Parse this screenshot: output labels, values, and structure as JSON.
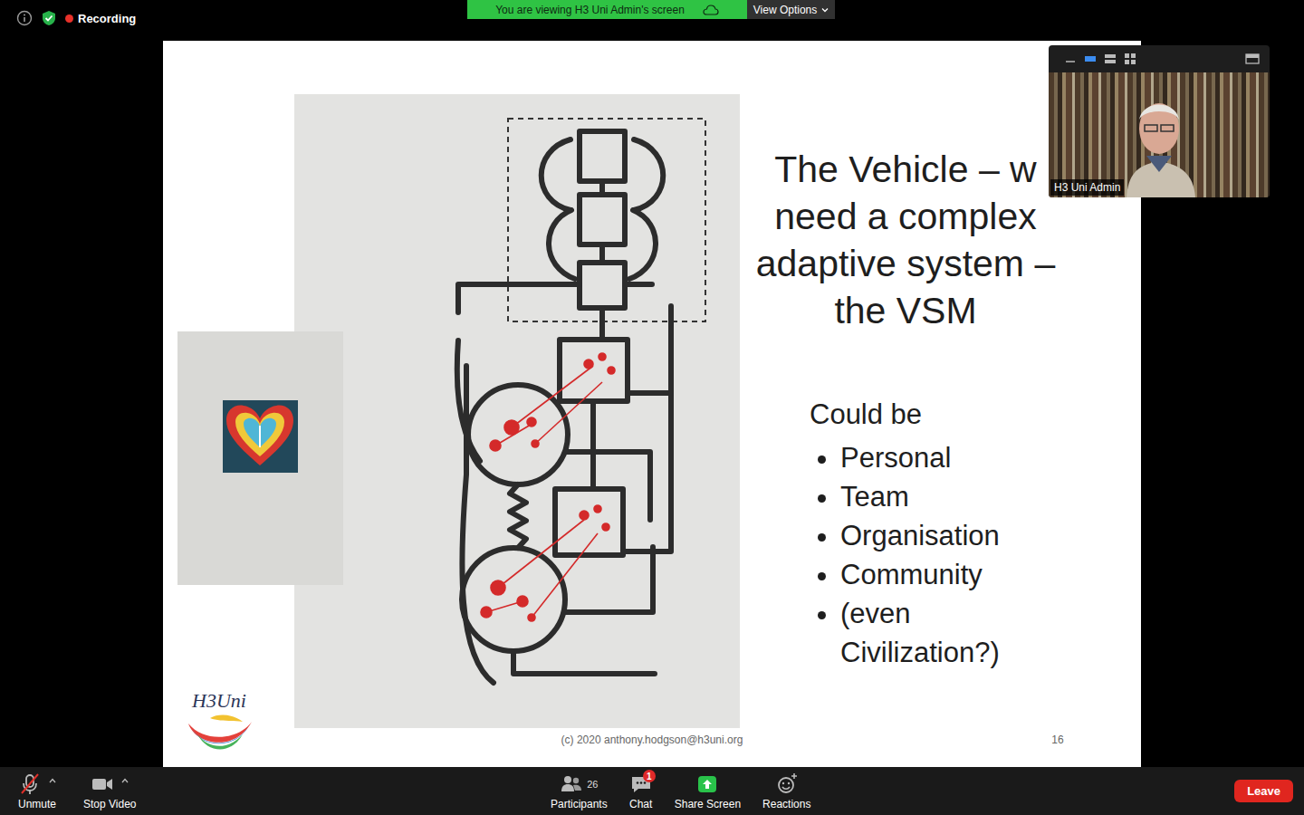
{
  "top_bar": {
    "recording": "Recording",
    "recording_on": true,
    "banner": "You are viewing H3 Uni Admin's screen",
    "view_options": "View Options"
  },
  "slide": {
    "title_lines": [
      "The Vehicle – w",
      "need a complex",
      "adaptive system –",
      "the VSM"
    ],
    "list_heading": "Could be",
    "items": [
      "Personal",
      "Team",
      "Organisation",
      "Community",
      "(even Civilization?)"
    ],
    "footer": "(c) 2020 anthony.hodgson@h3uni.org",
    "page": "16",
    "logo": "H3Uni"
  },
  "video": {
    "name": "H3 Uni Admin"
  },
  "toolbar": {
    "left": [
      {
        "label": "Unmute",
        "kind": "mic",
        "muted": true
      },
      {
        "label": "Stop Video",
        "kind": "video"
      }
    ],
    "center": [
      {
        "label": "Participants",
        "kind": "participants",
        "count": "26"
      },
      {
        "label": "Chat",
        "kind": "chat",
        "badge": "1"
      },
      {
        "label": "Share Screen",
        "kind": "share"
      },
      {
        "label": "Reactions",
        "kind": "reactions"
      }
    ],
    "leave": "Leave"
  }
}
